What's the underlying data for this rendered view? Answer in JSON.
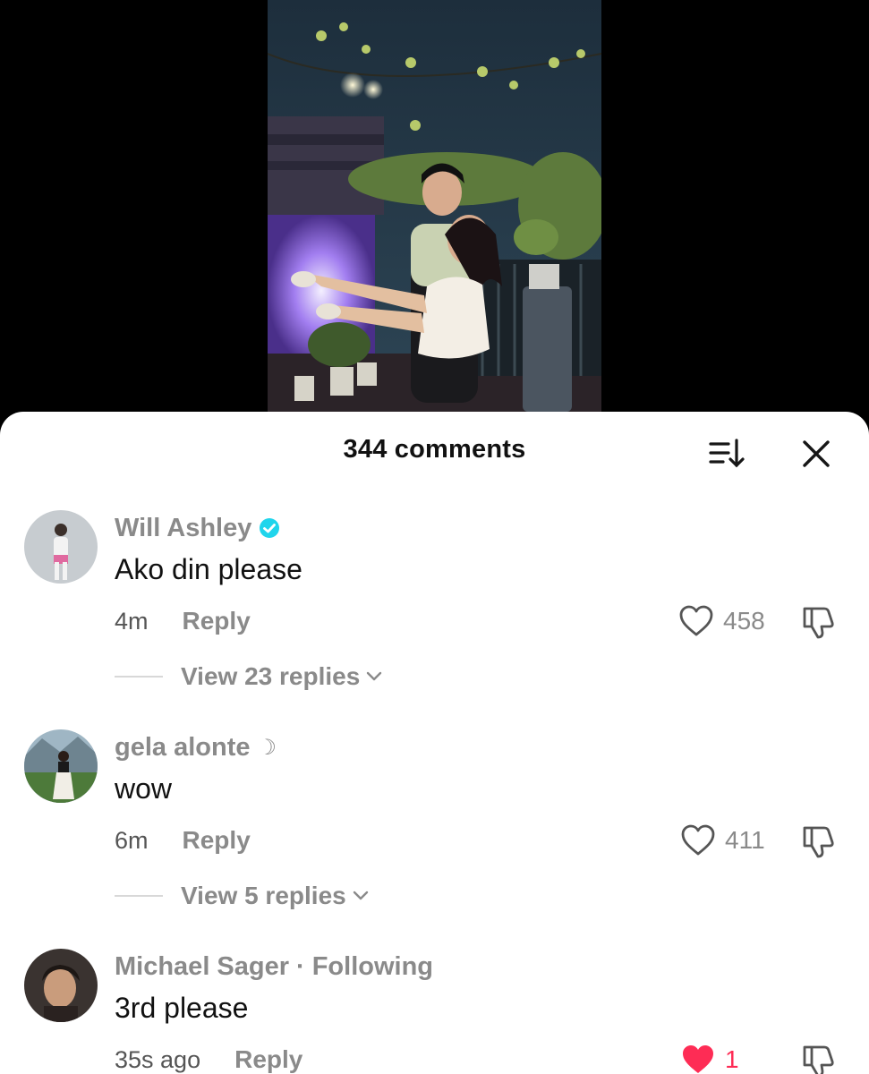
{
  "header": {
    "comment_count": "344 comments",
    "sort_icon": "sort-icon",
    "close_icon": "close-icon"
  },
  "comments": [
    {
      "username": "Will Ashley",
      "verified": true,
      "text": "Ako din please",
      "time": "4m",
      "reply_label": "Reply",
      "likes": "458",
      "liked": false,
      "view_replies": "View 23 replies"
    },
    {
      "username": "gela alonte",
      "badge": "☽",
      "text": "wow",
      "time": "6m",
      "reply_label": "Reply",
      "likes": "411",
      "liked": false,
      "view_replies": "View 5 replies"
    },
    {
      "username": "Michael Sager",
      "separator": "·",
      "following": "Following",
      "text": "3rd please",
      "time": "35s ago",
      "reply_label": "Reply",
      "likes": "1",
      "liked": true
    }
  ],
  "colors": {
    "like_active": "#fe2c55",
    "verified": "#20d5ec",
    "muted_text": "#8a8a8a"
  }
}
